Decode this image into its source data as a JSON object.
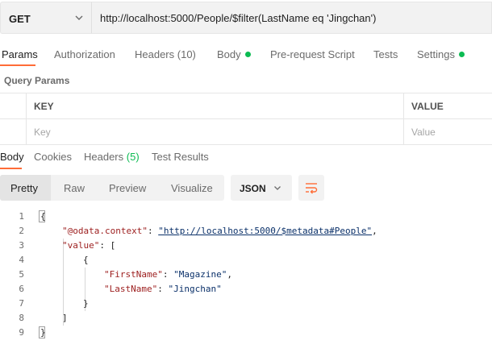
{
  "request": {
    "method": "GET",
    "url": "http://localhost:5000/People/$filter(LastName eq 'Jingchan')"
  },
  "request_tabs": [
    {
      "label": "Params"
    },
    {
      "label": "Authorization"
    },
    {
      "label": "Headers",
      "count": "(10)"
    },
    {
      "label": "Body"
    },
    {
      "label": "Pre-request Script"
    },
    {
      "label": "Tests"
    },
    {
      "label": "Settings"
    }
  ],
  "query_params": {
    "title": "Query Params",
    "columns": [
      "KEY",
      "VALUE"
    ],
    "placeholder_key": "Key",
    "placeholder_value": "Value"
  },
  "response_tabs": [
    {
      "label": "Body"
    },
    {
      "label": "Cookies"
    },
    {
      "label": "Headers",
      "count": "(5)"
    },
    {
      "label": "Test Results"
    }
  ],
  "view_modes": [
    "Pretty",
    "Raw",
    "Preview",
    "Visualize"
  ],
  "format": "JSON",
  "colors": {
    "accent": "#ff6c37",
    "dot": "#0cbb52"
  },
  "icons": {
    "method_dropdown": "chevron-down-icon",
    "format_dropdown": "chevron-down-icon",
    "wrap": "wrap-lines-icon"
  },
  "code": {
    "line_numbers": [
      "1",
      "2",
      "3",
      "4",
      "5",
      "6",
      "7",
      "8",
      "9"
    ],
    "open_brace": "{",
    "context_key": "\"@odata.context\"",
    "context_value": "\"http://localhost:5000/$metadata#People\"",
    "value_key": "\"value\"",
    "array_open": "[",
    "item_open": "{",
    "first_name_key": "\"FirstName\"",
    "first_name_value": "\"Magazine\"",
    "last_name_key": "\"LastName\"",
    "last_name_value": "\"Jingchan\"",
    "item_close": "}",
    "array_close": "]",
    "close_brace": "}"
  }
}
